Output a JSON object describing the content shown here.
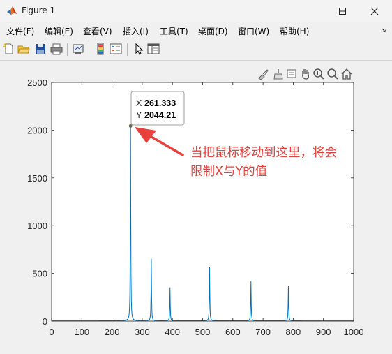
{
  "window": {
    "title": "Figure 1"
  },
  "menu": [
    "文件(F)",
    "编辑(E)",
    "查看(V)",
    "插入(I)",
    "工具(T)",
    "桌面(D)",
    "窗口(W)",
    "帮助(H)"
  ],
  "toolbar_icons": [
    "new-figure-icon",
    "open-file-icon",
    "save-icon",
    "print-icon",
    "link-plot-icon",
    "colorbar-icon",
    "legend-icon",
    "pointer-icon",
    "property-inspector-icon"
  ],
  "axes_toolbar_icons": [
    "brush-icon",
    "clean-icon",
    "data-tips-icon",
    "zoom-in-icon",
    "zoom-out-icon",
    "pan-icon",
    "home-icon"
  ],
  "datatip": {
    "x_label": "X",
    "x_value": "261.333",
    "y_label": "Y",
    "y_value": "2044.21"
  },
  "annotation": {
    "line1": "当把鼠标移动到这里，将会",
    "line2": "限制X与Y的值",
    "color": "#e8413d"
  },
  "chart_data": {
    "type": "line",
    "xlim": [
      0,
      1000
    ],
    "ylim": [
      0,
      2500
    ],
    "xticks": [
      0,
      100,
      200,
      300,
      400,
      500,
      600,
      700,
      800,
      900,
      1000
    ],
    "yticks": [
      0,
      500,
      1000,
      1500,
      2000,
      2500
    ],
    "grid": false,
    "line_color": "#0072bd",
    "series": [
      {
        "peaks": [
          {
            "x": 261.333,
            "y": 2044.21
          },
          {
            "x": 330,
            "y": 650
          },
          {
            "x": 392,
            "y": 350
          },
          {
            "x": 523,
            "y": 560
          },
          {
            "x": 660,
            "y": 415
          },
          {
            "x": 784,
            "y": 370
          }
        ]
      }
    ]
  }
}
